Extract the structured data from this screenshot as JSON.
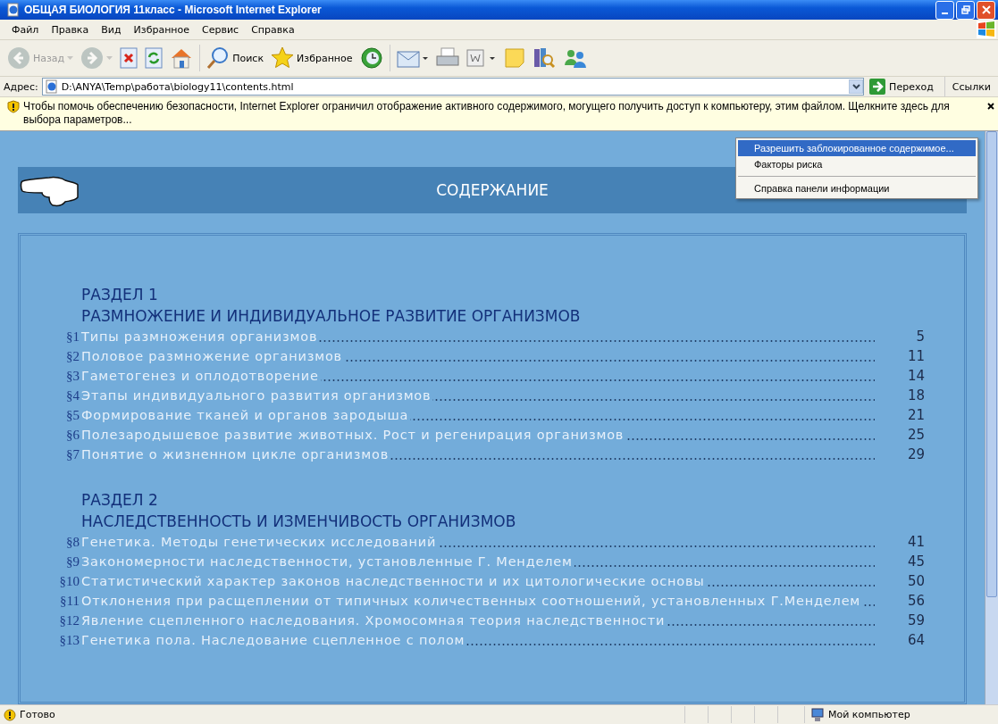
{
  "window": {
    "title": "ОБЩАЯ БИОЛОГИЯ 11класс - Microsoft Internet Explorer"
  },
  "menu": [
    "Файл",
    "Правка",
    "Вид",
    "Избранное",
    "Сервис",
    "Справка"
  ],
  "toolbar": [
    {
      "kind": "back",
      "label": "Назад",
      "disabled": true
    },
    {
      "kind": "forward",
      "disabled": true
    },
    {
      "kind": "stop",
      "disabled": false
    },
    {
      "kind": "refresh",
      "disabled": false
    },
    {
      "kind": "home",
      "disabled": false
    },
    {
      "kind": "search",
      "label": "Поиск",
      "disabled": false
    },
    {
      "kind": "favorites",
      "label": "Избранное",
      "disabled": false
    },
    {
      "kind": "history",
      "disabled": false
    },
    {
      "kind": "mail",
      "disabled": false
    },
    {
      "kind": "print",
      "disabled": false
    },
    {
      "kind": "word",
      "disabled": false
    },
    {
      "kind": "notes",
      "disabled": false
    },
    {
      "kind": "research",
      "disabled": false
    },
    {
      "kind": "messenger",
      "disabled": false
    }
  ],
  "address": {
    "label": "Адрес:",
    "value": "D:\\ANYA\\Temp\\работа\\biology11\\contents.html",
    "go": "Переход",
    "links": "Ссылки"
  },
  "infobar": {
    "text": "Чтобы помочь обеспечению безопасности, Internet Explorer ограничил отображение активного содержимого, могущего получить доступ к компьютеру, этим файлом. Щелкните здесь для выбора параметров...",
    "menu": [
      [
        {
          "label": "Разрешить заблокированное содержимое...",
          "selected": true
        },
        {
          "label": "Факторы риска",
          "selected": false
        }
      ],
      [
        {
          "label": "Справка панели информации",
          "selected": false
        }
      ]
    ]
  },
  "page": {
    "title": "СОДЕРЖАНИЕ",
    "sections": [
      {
        "heading": "РАЗДЕЛ 1",
        "title": "РАЗМНОЖЕНИЕ И ИНДИВИДУАЛЬНОЕ РАЗВИТИЕ ОРГАНИЗМОВ",
        "entries": [
          {
            "num": "§1",
            "text": "Типы размножения организмов",
            "page": "5"
          },
          {
            "num": "§2",
            "text": "Половое размножение организмов",
            "page": "11"
          },
          {
            "num": "§3",
            "text": "Гаметогенез и оплодотворение",
            "page": "14"
          },
          {
            "num": "§4",
            "text": "Этапы индивидуального развития организмов",
            "page": "18"
          },
          {
            "num": "§5",
            "text": "Формирование тканей и органов зародыша",
            "page": "21"
          },
          {
            "num": "§6",
            "text": "Полезародышевое развитие животных. Рост и регенирация организмов",
            "page": "25"
          },
          {
            "num": "§7",
            "text": "Понятие о жизненном цикле организмов",
            "page": "29"
          }
        ]
      },
      {
        "heading": "РАЗДЕЛ 2",
        "title": "НАСЛЕДСТВЕННОСТЬ И ИЗМЕНЧИВОСТЬ ОРГАНИЗМОВ",
        "entries": [
          {
            "num": "§8",
            "text": "Генетика. Методы генетических исследований",
            "page": "41"
          },
          {
            "num": "§9",
            "text": "Закономерности наследственности, установленные Г. Менделем",
            "page": "45"
          },
          {
            "num": "§10",
            "text": "Статистический характер законов наследственности и их цитологические основы",
            "page": "50"
          },
          {
            "num": "§11",
            "text": "Отклонения при расщеплении от типичных количественных соотношений, установленных Г.Менделем",
            "page": "56"
          },
          {
            "num": "§12",
            "text": "Явление сцепленного наследования. Хромосомная теория наследственности",
            "page": "59"
          },
          {
            "num": "§13",
            "text": "Генетика пола. Наследование сцепленное с полом",
            "page": "64"
          }
        ]
      }
    ]
  },
  "status": {
    "text": "Готово",
    "zone": "Мой компьютер"
  }
}
